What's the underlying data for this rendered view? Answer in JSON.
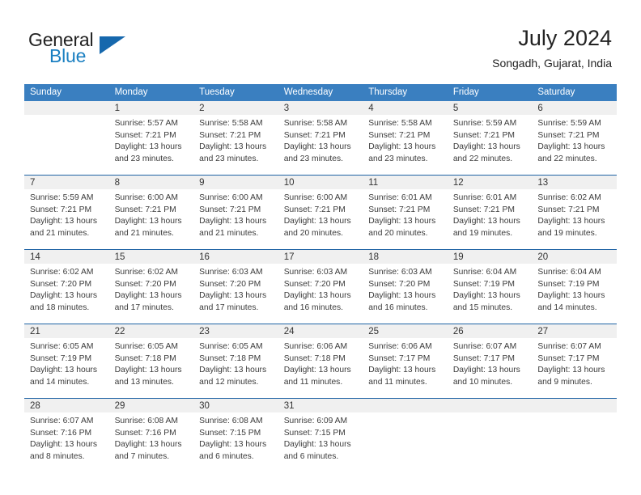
{
  "brand": {
    "name_part1": "General",
    "name_part2": "Blue",
    "flag_icon": "triangle-flag-icon",
    "accent_color": "#1668ad"
  },
  "header": {
    "title": "July 2024",
    "subtitle": "Songadh, Gujarat, India"
  },
  "theme": {
    "header_blue": "#3a7fc0",
    "separator_blue": "#1f63a5",
    "daynum_band": "#f0f0f0",
    "text": "#3b3b3b"
  },
  "weekdays": [
    "Sunday",
    "Monday",
    "Tuesday",
    "Wednesday",
    "Thursday",
    "Friday",
    "Saturday"
  ],
  "weeks": [
    {
      "days": [
        {
          "day": "",
          "lines": []
        },
        {
          "day": "1",
          "lines": [
            "Sunrise: 5:57 AM",
            "Sunset: 7:21 PM",
            "Daylight: 13 hours",
            "and 23 minutes."
          ]
        },
        {
          "day": "2",
          "lines": [
            "Sunrise: 5:58 AM",
            "Sunset: 7:21 PM",
            "Daylight: 13 hours",
            "and 23 minutes."
          ]
        },
        {
          "day": "3",
          "lines": [
            "Sunrise: 5:58 AM",
            "Sunset: 7:21 PM",
            "Daylight: 13 hours",
            "and 23 minutes."
          ]
        },
        {
          "day": "4",
          "lines": [
            "Sunrise: 5:58 AM",
            "Sunset: 7:21 PM",
            "Daylight: 13 hours",
            "and 23 minutes."
          ]
        },
        {
          "day": "5",
          "lines": [
            "Sunrise: 5:59 AM",
            "Sunset: 7:21 PM",
            "Daylight: 13 hours",
            "and 22 minutes."
          ]
        },
        {
          "day": "6",
          "lines": [
            "Sunrise: 5:59 AM",
            "Sunset: 7:21 PM",
            "Daylight: 13 hours",
            "and 22 minutes."
          ]
        }
      ]
    },
    {
      "days": [
        {
          "day": "7",
          "lines": [
            "Sunrise: 5:59 AM",
            "Sunset: 7:21 PM",
            "Daylight: 13 hours",
            "and 21 minutes."
          ]
        },
        {
          "day": "8",
          "lines": [
            "Sunrise: 6:00 AM",
            "Sunset: 7:21 PM",
            "Daylight: 13 hours",
            "and 21 minutes."
          ]
        },
        {
          "day": "9",
          "lines": [
            "Sunrise: 6:00 AM",
            "Sunset: 7:21 PM",
            "Daylight: 13 hours",
            "and 21 minutes."
          ]
        },
        {
          "day": "10",
          "lines": [
            "Sunrise: 6:00 AM",
            "Sunset: 7:21 PM",
            "Daylight: 13 hours",
            "and 20 minutes."
          ]
        },
        {
          "day": "11",
          "lines": [
            "Sunrise: 6:01 AM",
            "Sunset: 7:21 PM",
            "Daylight: 13 hours",
            "and 20 minutes."
          ]
        },
        {
          "day": "12",
          "lines": [
            "Sunrise: 6:01 AM",
            "Sunset: 7:21 PM",
            "Daylight: 13 hours",
            "and 19 minutes."
          ]
        },
        {
          "day": "13",
          "lines": [
            "Sunrise: 6:02 AM",
            "Sunset: 7:21 PM",
            "Daylight: 13 hours",
            "and 19 minutes."
          ]
        }
      ]
    },
    {
      "days": [
        {
          "day": "14",
          "lines": [
            "Sunrise: 6:02 AM",
            "Sunset: 7:20 PM",
            "Daylight: 13 hours",
            "and 18 minutes."
          ]
        },
        {
          "day": "15",
          "lines": [
            "Sunrise: 6:02 AM",
            "Sunset: 7:20 PM",
            "Daylight: 13 hours",
            "and 17 minutes."
          ]
        },
        {
          "day": "16",
          "lines": [
            "Sunrise: 6:03 AM",
            "Sunset: 7:20 PM",
            "Daylight: 13 hours",
            "and 17 minutes."
          ]
        },
        {
          "day": "17",
          "lines": [
            "Sunrise: 6:03 AM",
            "Sunset: 7:20 PM",
            "Daylight: 13 hours",
            "and 16 minutes."
          ]
        },
        {
          "day": "18",
          "lines": [
            "Sunrise: 6:03 AM",
            "Sunset: 7:20 PM",
            "Daylight: 13 hours",
            "and 16 minutes."
          ]
        },
        {
          "day": "19",
          "lines": [
            "Sunrise: 6:04 AM",
            "Sunset: 7:19 PM",
            "Daylight: 13 hours",
            "and 15 minutes."
          ]
        },
        {
          "day": "20",
          "lines": [
            "Sunrise: 6:04 AM",
            "Sunset: 7:19 PM",
            "Daylight: 13 hours",
            "and 14 minutes."
          ]
        }
      ]
    },
    {
      "days": [
        {
          "day": "21",
          "lines": [
            "Sunrise: 6:05 AM",
            "Sunset: 7:19 PM",
            "Daylight: 13 hours",
            "and 14 minutes."
          ]
        },
        {
          "day": "22",
          "lines": [
            "Sunrise: 6:05 AM",
            "Sunset: 7:18 PM",
            "Daylight: 13 hours",
            "and 13 minutes."
          ]
        },
        {
          "day": "23",
          "lines": [
            "Sunrise: 6:05 AM",
            "Sunset: 7:18 PM",
            "Daylight: 13 hours",
            "and 12 minutes."
          ]
        },
        {
          "day": "24",
          "lines": [
            "Sunrise: 6:06 AM",
            "Sunset: 7:18 PM",
            "Daylight: 13 hours",
            "and 11 minutes."
          ]
        },
        {
          "day": "25",
          "lines": [
            "Sunrise: 6:06 AM",
            "Sunset: 7:17 PM",
            "Daylight: 13 hours",
            "and 11 minutes."
          ]
        },
        {
          "day": "26",
          "lines": [
            "Sunrise: 6:07 AM",
            "Sunset: 7:17 PM",
            "Daylight: 13 hours",
            "and 10 minutes."
          ]
        },
        {
          "day": "27",
          "lines": [
            "Sunrise: 6:07 AM",
            "Sunset: 7:17 PM",
            "Daylight: 13 hours",
            "and 9 minutes."
          ]
        }
      ]
    },
    {
      "days": [
        {
          "day": "28",
          "lines": [
            "Sunrise: 6:07 AM",
            "Sunset: 7:16 PM",
            "Daylight: 13 hours",
            "and 8 minutes."
          ]
        },
        {
          "day": "29",
          "lines": [
            "Sunrise: 6:08 AM",
            "Sunset: 7:16 PM",
            "Daylight: 13 hours",
            "and 7 minutes."
          ]
        },
        {
          "day": "30",
          "lines": [
            "Sunrise: 6:08 AM",
            "Sunset: 7:15 PM",
            "Daylight: 13 hours",
            "and 6 minutes."
          ]
        },
        {
          "day": "31",
          "lines": [
            "Sunrise: 6:09 AM",
            "Sunset: 7:15 PM",
            "Daylight: 13 hours",
            "and 6 minutes."
          ]
        },
        {
          "day": "",
          "lines": []
        },
        {
          "day": "",
          "lines": []
        },
        {
          "day": "",
          "lines": []
        }
      ]
    }
  ]
}
